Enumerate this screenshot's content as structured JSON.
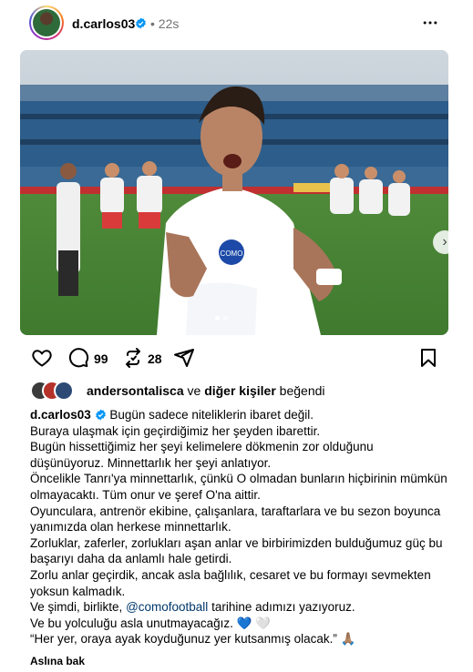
{
  "post": {
    "username": "d.carlos03",
    "separator": "•",
    "timestamp": "22s"
  },
  "actions": {
    "comments_count": "99",
    "reposts_count": "28"
  },
  "likes": {
    "user": "andersontalisca",
    "connector": "ve",
    "others": "diğer kişiler",
    "suffix": "beğendi"
  },
  "caption": {
    "username": "d.carlos03",
    "lines": [
      "Bugün sadece niteliklerin ibaret değil.",
      "Buraya ulaşmak için geçirdiğimiz her şeyden ibarettir.",
      "Bugün hissettiğimiz her şeyi kelimelere dökmenin zor olduğunu düşünüyoruz. Minnettarlık her şeyi anlatıyor.",
      "Öncelikle Tanrı'ya minnettarlık, çünkü O olmadan bunların hiçbirinin mümkün olmayacaktı. Tüm onur ve şeref O'na aittir.",
      "Oyunculara, antrenör ekibine, çalışanlara, taraftarlara ve bu sezon boyunca yanımızda olan herkese minnettarlık.",
      "Zorluklar, zaferler, zorlukları aşan anlar ve birbirimizden bulduğumuz güç bu başarıyı daha da anlamlı hale getirdi.",
      "Zorlu anlar geçirdik, ancak asla bağlılık, cesaret ve bu formayı sevmekten yoksun kalmadık."
    ],
    "mention_prefix": "Ve şimdi, birlikte,",
    "mention": "@comofootball",
    "mention_suffix": "tarihine adımızı yazıyoruz.",
    "line_with_hearts": "Ve bu yolculuğu asla unutmayacağız.",
    "hearts": "💙 🤍",
    "quote": "“Her yer, oraya ayak koyduğunuz yer kutsanmış olacak.”",
    "pray_emoji": "🙏🏽"
  },
  "see_original": "Aslına bak",
  "icons": {
    "verified": "verified-badge-icon",
    "more": "more-options-icon",
    "like": "heart-icon",
    "comment": "comment-icon",
    "repost": "repost-icon",
    "share": "share-icon",
    "save": "bookmark-icon",
    "next": "chevron-right-icon"
  },
  "colors": {
    "verified": "#0095f6",
    "mention": "#00376b",
    "secondary_text": "#737373"
  }
}
